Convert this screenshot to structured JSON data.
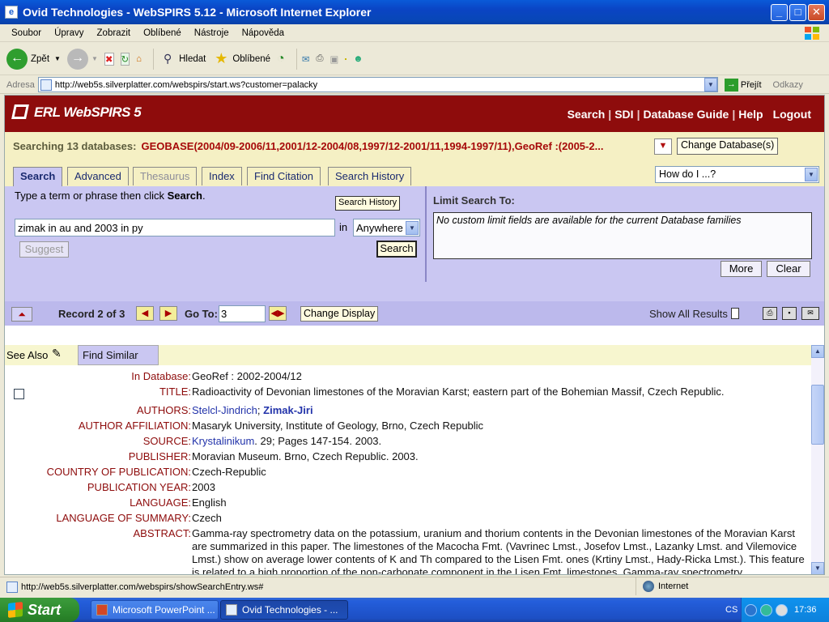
{
  "window": {
    "title": "Ovid Technologies - WebSPIRS 5.12 - Microsoft Internet Explorer"
  },
  "menu": [
    "Soubor",
    "Úpravy",
    "Zobrazit",
    "Oblíbené",
    "Nástroje",
    "Nápověda"
  ],
  "toolbar": {
    "back": "Zpět",
    "search": "Hledat",
    "favorites": "Oblíbené"
  },
  "address": {
    "label": "Adresa",
    "url": "http://web5s.silverplatter.com/webspirs/start.ws?customer=palacky",
    "go": "Přejít",
    "links": "Odkazy"
  },
  "brand": {
    "logo": "ERL WebSPIRS 5",
    "nav": [
      "Search",
      "SDI",
      "Database Guide",
      "Help",
      "Logout"
    ]
  },
  "searching": {
    "label": "Searching 13 databases:",
    "databases": "GEOBASE(2004/09-2006/11,2001/12-2004/08,1997/12-2001/11,1994-1997/11),GeoRef :(2005-2...",
    "change_button": "Change Database(s)"
  },
  "tabs": [
    {
      "label": "Search",
      "state": "active"
    },
    {
      "label": "Advanced",
      "state": "normal"
    },
    {
      "label": "Thesaurus",
      "state": "disabled"
    },
    {
      "label": "Index",
      "state": "normal"
    },
    {
      "label": "Find Citation",
      "state": "normal"
    },
    {
      "label": "Search History",
      "state": "normal"
    }
  ],
  "howdo": {
    "value": "How do I ...?"
  },
  "search": {
    "instruction_pre": "Type a term or phrase then click ",
    "instruction_bold": "Search",
    "instruction_post": ".",
    "history_button": "Search History",
    "query": "zimak in au and 2003 in py",
    "in_label": "in",
    "field": "Anywhere",
    "suggest": "Suggest",
    "search_button": "Search"
  },
  "limit": {
    "title": "Limit Search To:",
    "message": "No custom limit fields are available for the current Database families",
    "more": "More",
    "clear": "Clear"
  },
  "record": {
    "label": "Record 2 of 3",
    "goto_label": "Go To:",
    "goto_value": "3",
    "change_display": "Change Display",
    "show_all": "Show All Results"
  },
  "seealso": {
    "label": "See Also",
    "find_similar": "Find Similar"
  },
  "fields": [
    {
      "key": "In Database:",
      "value": "GeoRef : 2002-2004/12"
    },
    {
      "key": "TITLE:",
      "value": "Radioactivity of Devonian limestones of the Moravian Karst; eastern part of the Bohemian Massif, Czech Republic."
    },
    {
      "key": "AUTHORS:",
      "author1": "Stelcl-Jindrich",
      "sep": "; ",
      "author2": "Zimak-Jiri"
    },
    {
      "key": "AUTHOR AFFILIATION:",
      "value": "Masaryk University, Institute of Geology, Brno, Czech Republic"
    },
    {
      "key": "SOURCE:",
      "link": "Krystalinikum",
      "value": ". 29; Pages 147-154. 2003."
    },
    {
      "key": "PUBLISHER:",
      "value": "Moravian Museum. Brno, Czech Republic. 2003."
    },
    {
      "key": "COUNTRY OF PUBLICATION:",
      "value": "Czech-Republic"
    },
    {
      "key": "PUBLICATION YEAR:",
      "value": "2003"
    },
    {
      "key": "LANGUAGE:",
      "value": "English"
    },
    {
      "key": "LANGUAGE OF SUMMARY:",
      "value": "Czech"
    },
    {
      "key": "ABSTRACT:",
      "value": "Gamma-ray spectrometry data on the potassium, uranium and thorium contents in the Devonian limestones of the Moravian Karst are summarized in this paper. The limestones of the Macocha Fmt. (Vavrinec Lmst., Josefov Lmst., Lazanky Lmst. and Vilemovice Lmst.) show on average lower contents of K and Th compared to the Lisen Fmt. ones (Krtiny Lmst., Hady-Ricka Lmst.). This feature is related to a high proportion of the non-carbonate component in the Lisen Fmt. limestones. Gamma-ray spectrometry"
    }
  ],
  "status": {
    "url": "http://web5s.silverplatter.com/webspirs/showSearchEntry.ws#",
    "zone": "Internet"
  },
  "taskbar": {
    "start": "Start",
    "tasks": [
      {
        "label": "Microsoft PowerPoint ...",
        "active": false
      },
      {
        "label": "Ovid Technologies - ...",
        "active": true
      }
    ],
    "lang": "CS",
    "clock": "17:36"
  }
}
